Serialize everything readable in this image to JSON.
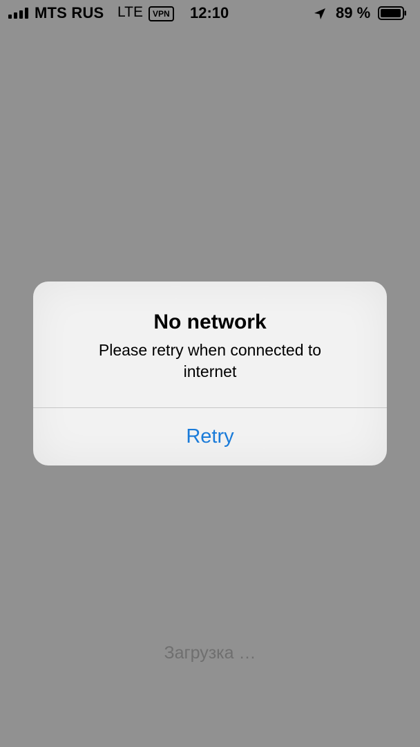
{
  "status_bar": {
    "carrier": "MTS RUS",
    "network_type": "LTE",
    "vpn_label": "VPN",
    "time": "12:10",
    "battery_percent": "89 %",
    "icons": [
      "signal-icon",
      "location-arrow-icon",
      "battery-icon"
    ]
  },
  "alert": {
    "title": "No network",
    "message": "Please retry when connected to internet",
    "button_label": "Retry",
    "accent_color": "#1a7bd9"
  },
  "loading_text": "Загрузка …",
  "colors": {
    "background": "#919191",
    "alert_background": "#f2f2f2",
    "loading_text": "#6f6f6f"
  }
}
